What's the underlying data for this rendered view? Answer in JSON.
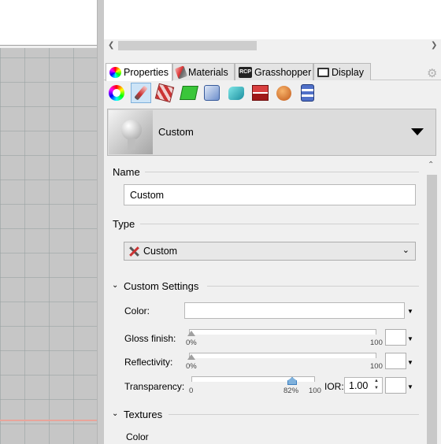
{
  "tabs": [
    {
      "label": "Properties",
      "icon": "color-wheel-icon",
      "active": true
    },
    {
      "label": "Materials",
      "icon": "paint-brush-icon",
      "active": false
    },
    {
      "label": "Grasshopper",
      "icon": "rcp-icon",
      "active": false
    },
    {
      "label": "Display",
      "icon": "monitor-icon",
      "active": false
    }
  ],
  "rcp_badge": "RCP",
  "toolbar_icons": [
    "object-properties-icon",
    "material-icon",
    "decal-icon",
    "mapping-icon",
    "clipping-icon",
    "displacement-icon",
    "thickness-icon",
    "texture-icon",
    "attributes-icon"
  ],
  "material": {
    "name": "Custom"
  },
  "name_section": {
    "label": "Name",
    "value": "Custom"
  },
  "type_section": {
    "label": "Type",
    "value": "Custom"
  },
  "custom_settings": {
    "label": "Custom Settings",
    "color_label": "Color:",
    "gloss": {
      "label": "Gloss finish:",
      "min": "0%",
      "max": "100",
      "value": 0
    },
    "reflectivity": {
      "label": "Reflectivity:",
      "min": "0%",
      "max": "100",
      "value": 0
    },
    "transparency": {
      "label": "Transparency:",
      "min": "0",
      "max": "100",
      "value_label": "82%",
      "value": 82
    },
    "ior": {
      "label": "IOR:",
      "value": "1.00"
    }
  },
  "textures": {
    "label": "Textures",
    "first_item": "Color"
  },
  "colors": {
    "accent": "#7fb1dc",
    "selected": "#cde4f7",
    "grid": "#c6c6c6",
    "redline": "#e8a59b"
  }
}
